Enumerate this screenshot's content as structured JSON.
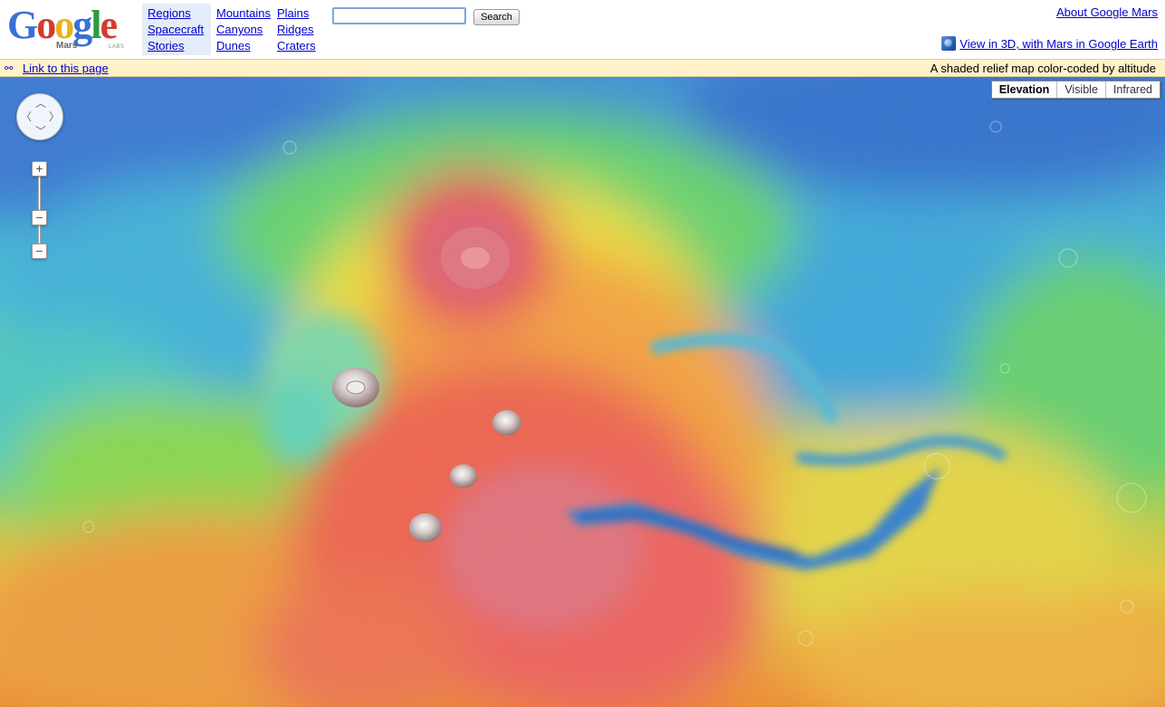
{
  "logo": {
    "word": "Google",
    "product": "Mars",
    "badge": "LABS"
  },
  "nav": {
    "col1": [
      "Regions",
      "Spacecraft",
      "Stories"
    ],
    "col2": [
      "Mountains",
      "Canyons",
      "Dunes"
    ],
    "col3": [
      "Plains",
      "Ridges",
      "Craters"
    ]
  },
  "search": {
    "value": "",
    "button_label": "Search"
  },
  "header_links": {
    "about": "About Google Mars",
    "earth": "View in 3D, with Mars in Google Earth"
  },
  "infobar": {
    "link_label": "Link to this page",
    "description": "A shaded relief map color-coded by altitude"
  },
  "map_types": [
    {
      "label": "Elevation",
      "active": true
    },
    {
      "label": "Visible",
      "active": false
    },
    {
      "label": "Infrared",
      "active": false
    }
  ],
  "zoom_controls": {
    "in": "+",
    "mid": "−",
    "out": "−"
  },
  "colors": {
    "link": "#0000cc",
    "infobar_bg": "#fff1c8",
    "nav_highlight": "#e5ecf9"
  },
  "icons": [
    "link-chain-icon",
    "google-earth-icon",
    "pan-control-icon",
    "zoom-in-icon",
    "zoom-out-icon"
  ]
}
